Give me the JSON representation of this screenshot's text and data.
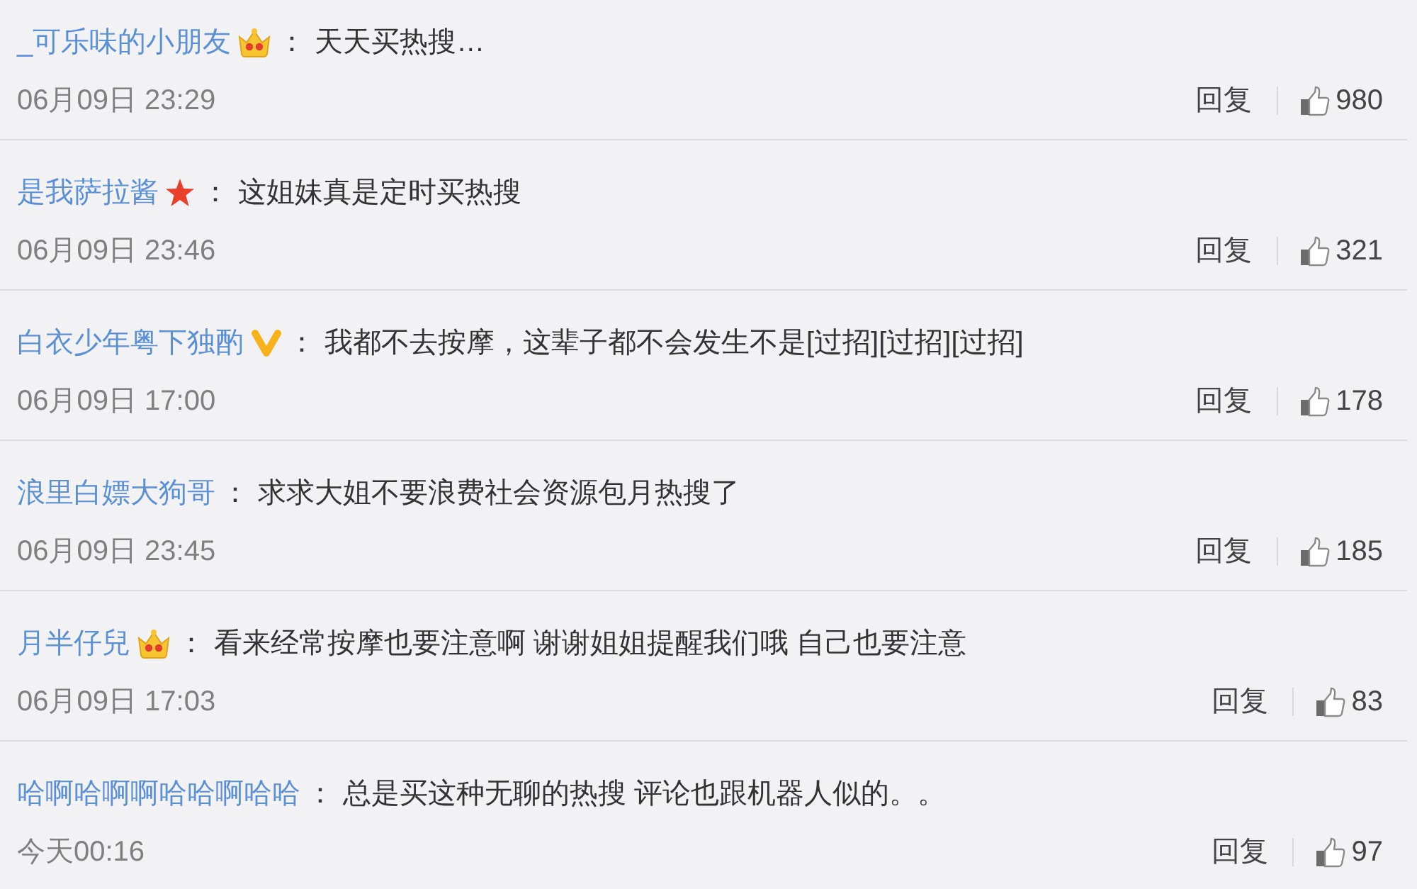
{
  "comments": [
    {
      "user": "_可乐味的小朋友",
      "kind": "crown",
      "colon": "：",
      "text": "天天买热搜…",
      "time": "06月09日 23:29",
      "reply": "回复",
      "likes": "980"
    },
    {
      "user": "是我萨拉酱",
      "kind": "star",
      "colon": "：",
      "text": "这姐妹真是定时买热搜",
      "time": "06月09日 23:46",
      "reply": "回复",
      "likes": "321"
    },
    {
      "user": "白衣少年粤下独酌",
      "kind": "verified",
      "colon": "：",
      "text": "我都不去按摩，这辈子都不会发生不是[过招][过招][过招]",
      "time": "06月09日 17:00",
      "reply": "回复",
      "likes": "178"
    },
    {
      "user": "浪里白嫖大狗哥",
      "kind": "plain",
      "colon": "：",
      "text": "求求大姐不要浪费社会资源包月热搜了",
      "time": "06月09日 23:45",
      "reply": "回复",
      "likes": "185"
    },
    {
      "user": "月半仔兒",
      "kind": "crown",
      "colon": "：",
      "text": "看来经常按摩也要注意啊 谢谢姐姐提醒我们哦 自己也要注意",
      "time": "06月09日 17:03",
      "reply": "回复",
      "likes": "83"
    },
    {
      "user": "哈啊哈啊啊哈哈啊哈哈",
      "kind": "plain",
      "colon": "：",
      "text": "总是买这种无聊的热搜 评论也跟机器人似的。。",
      "time": "今天00:16",
      "reply": "回复",
      "likes": "97"
    }
  ]
}
